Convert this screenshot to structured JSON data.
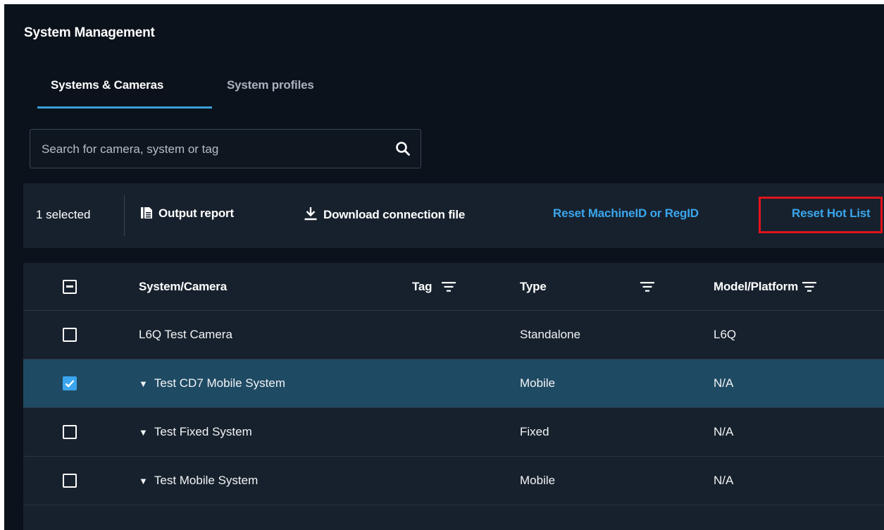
{
  "page": {
    "title": "System Management"
  },
  "tabs": [
    {
      "label": "Systems & Cameras",
      "active": true
    },
    {
      "label": "System profiles",
      "active": false
    }
  ],
  "search": {
    "placeholder": "Search for camera, system or tag",
    "value": ""
  },
  "action_bar": {
    "selected_count": "1 selected",
    "output_report": "Output report",
    "download_connection_file": "Download connection file",
    "reset_machine_id": "Reset MachineID or RegID",
    "reset_hot_list": "Reset Hot List"
  },
  "table": {
    "columns": [
      "System/Camera",
      "Tag",
      "Type",
      "Model/Platform"
    ],
    "rows": [
      {
        "name": "L6Q Test Camera",
        "expandable": false,
        "tag": "",
        "type": "Standalone",
        "model": "L6Q",
        "selected": false
      },
      {
        "name": "Test CD7 Mobile System",
        "expandable": true,
        "tag": "",
        "type": "Mobile",
        "model": "N/A",
        "selected": true
      },
      {
        "name": "Test Fixed System",
        "expandable": true,
        "tag": "",
        "type": "Fixed",
        "model": "N/A",
        "selected": false
      },
      {
        "name": "Test Mobile System",
        "expandable": true,
        "tag": "",
        "type": "Mobile",
        "model": "N/A",
        "selected": false
      }
    ]
  },
  "colors": {
    "accent": "#3aa6ee",
    "tab_underline": "#3a9fd9",
    "selected_row": "#1f4a63",
    "highlight": "#e0141b",
    "background": "#0b121b",
    "panel": "#17212d"
  },
  "icons": {
    "search": "search-icon",
    "output_report": "report-icon",
    "download": "download-icon",
    "filter": "filter-icon",
    "expand": "caret-down-icon"
  }
}
